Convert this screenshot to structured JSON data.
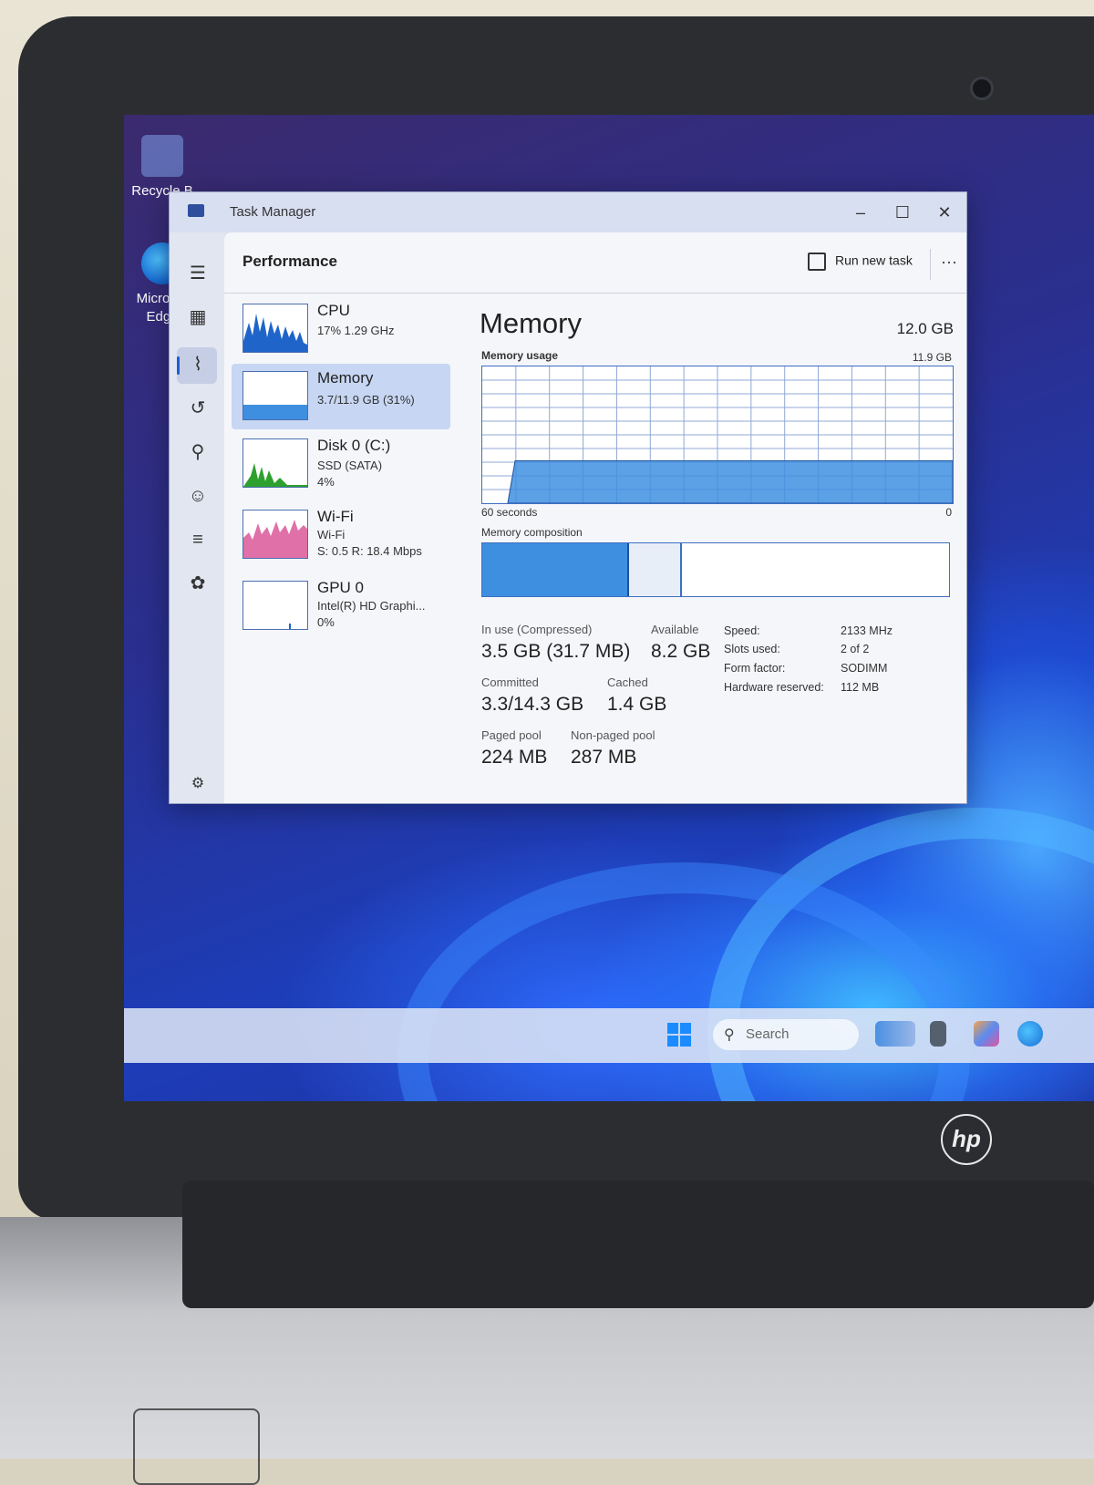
{
  "desktop": {
    "icons": [
      {
        "label": "Recycle B"
      },
      {
        "label": "Microsof Edge"
      }
    ],
    "taskbar": {
      "search_placeholder": "Search"
    }
  },
  "window": {
    "title": "Task Manager",
    "controls": {
      "minimize": "–",
      "maximize": "☐",
      "close": "✕"
    }
  },
  "header": {
    "page_title": "Performance",
    "run_new_task_label": "Run new task",
    "more_label": "···"
  },
  "devices": [
    {
      "name": "CPU",
      "line1": "17%  1.29 GHz",
      "line2": ""
    },
    {
      "name": "Memory",
      "line1": "3.7/11.9 GB (31%)",
      "line2": ""
    },
    {
      "name": "Disk 0 (C:)",
      "line1": "SSD (SATA)",
      "line2": "4%"
    },
    {
      "name": "Wi-Fi",
      "line1": "Wi-Fi",
      "line2": "S: 0.5  R: 18.4 Mbps"
    },
    {
      "name": "GPU 0",
      "line1": "Intel(R) HD Graphi...",
      "line2": "0%"
    }
  ],
  "memory": {
    "title": "Memory",
    "total": "12.0 GB",
    "usage_label": "Memory usage",
    "usage_max": "11.9 GB",
    "time_label": "60 seconds",
    "time_end": "0",
    "composition_label": "Memory composition",
    "usage_level": 0.31,
    "composition": {
      "in_use": 0.31,
      "modified": 0.11,
      "standby": 0.58
    },
    "stats": {
      "in_use_label": "In use (Compressed)",
      "in_use_value": "3.5 GB (31.7 MB)",
      "available_label": "Available",
      "available_value": "8.2 GB",
      "committed_label": "Committed",
      "committed_value": "3.3/14.3 GB",
      "cached_label": "Cached",
      "cached_value": "1.4 GB",
      "paged_label": "Paged pool",
      "paged_value": "224 MB",
      "nonpaged_label": "Non-paged pool",
      "nonpaged_value": "287 MB"
    },
    "specs": [
      {
        "key": "Speed:",
        "value": "2133 MHz"
      },
      {
        "key": "Slots used:",
        "value": "2 of 2"
      },
      {
        "key": "Form factor:",
        "value": "SODIMM"
      },
      {
        "key": "Hardware reserved:",
        "value": "112 MB"
      }
    ]
  },
  "brand": {
    "logo_text": "hp"
  },
  "colors": {
    "accent": "#1a5fd6",
    "memory_fill": "#3f8fe0",
    "cpu_fill": "#1f64c8",
    "disk_fill": "#2ea02e",
    "wifi_fill": "#e070a8"
  }
}
